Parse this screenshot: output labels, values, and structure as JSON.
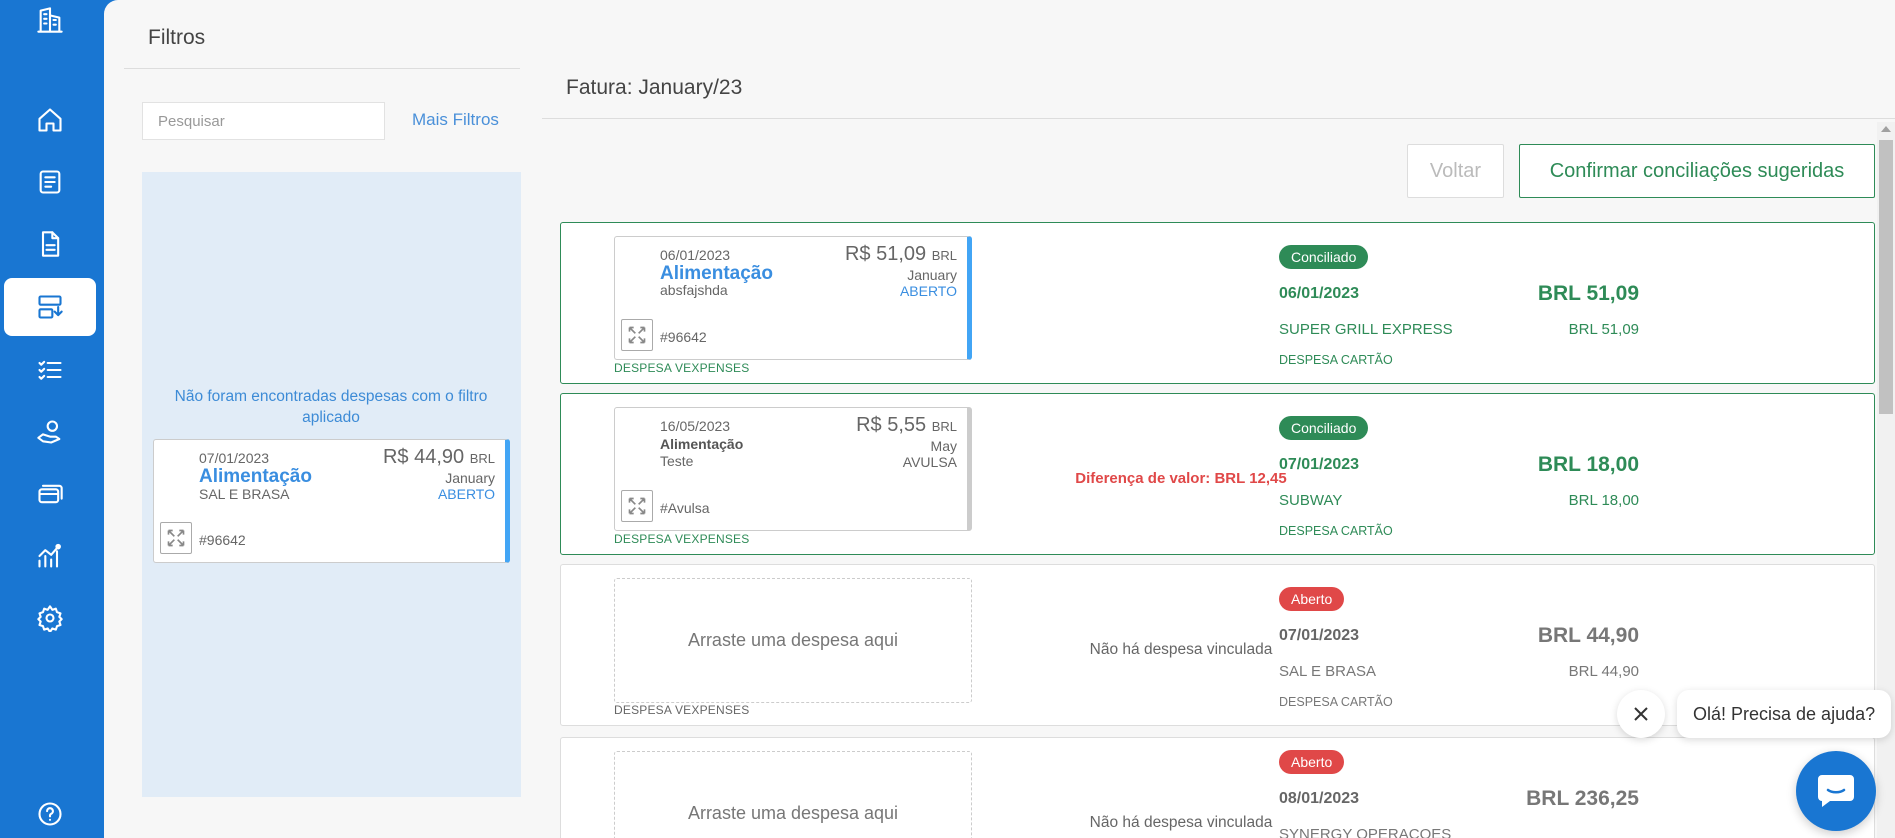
{
  "sidebar": {
    "items": [
      {
        "icon": "building-icon"
      },
      {
        "icon": "home-icon"
      },
      {
        "icon": "receipt-icon"
      },
      {
        "icon": "document-icon"
      },
      {
        "icon": "reconcile-icon",
        "active": true
      },
      {
        "icon": "checklist-icon"
      },
      {
        "icon": "hand-coin-icon"
      },
      {
        "icon": "cards-icon"
      },
      {
        "icon": "analytics-icon"
      },
      {
        "icon": "settings-icon"
      },
      {
        "icon": "help-icon"
      }
    ]
  },
  "filters": {
    "title": "Filtros",
    "search_placeholder": "Pesquisar",
    "more_filters": "Mais Filtros",
    "no_results": "Não foram encontradas despesas com o filtro aplicado",
    "card": {
      "date": "07/01/2023",
      "category": "Alimentação",
      "description": "SAL E BRASA",
      "amount": "R$ 44,90",
      "currency": "BRL",
      "month": "January",
      "status": "ABERTO",
      "id": "#96642"
    }
  },
  "main": {
    "title": "Fatura: January/23",
    "back_button": "Voltar",
    "confirm_button": "Confirmar conciliações sugeridas",
    "expense_label": "DESPESA VEXPENSES",
    "drop_text": "Arraste uma despesa aqui",
    "no_link_text": "Não há despesa vinculada",
    "rows": [
      {
        "expense": {
          "date": "06/01/2023",
          "category": "Alimentação",
          "description": "absfajshda",
          "amount": "R$ 51,09",
          "currency": "BRL",
          "month": "January",
          "status": "ABERTO",
          "id": "#96642"
        },
        "card": {
          "badge": "Conciliado",
          "date": "06/01/2023",
          "total": "BRL 51,09",
          "merchant": "SUPER GRILL EXPRESS",
          "amount": "BRL 51,09",
          "type": "DESPESA CARTÃO"
        }
      },
      {
        "expense": {
          "date": "16/05/2023",
          "category": "Alimentação",
          "description": "Teste",
          "amount": "R$ 5,55",
          "currency": "BRL",
          "month": "May",
          "status": "AVULSA",
          "id": "#Avulsa"
        },
        "difference": "Diferença de valor: BRL 12,45",
        "card": {
          "badge": "Conciliado",
          "date": "07/01/2023",
          "total": "BRL 18,00",
          "merchant": "SUBWAY",
          "amount": "BRL 18,00",
          "type": "DESPESA CARTÃO"
        }
      },
      {
        "card": {
          "badge": "Aberto",
          "date": "07/01/2023",
          "total": "BRL 44,90",
          "merchant": "SAL E BRASA",
          "amount": "BRL 44,90",
          "type": "DESPESA CARTÃO"
        }
      },
      {
        "card": {
          "badge": "Aberto",
          "date": "08/01/2023",
          "total": "BRL 236,25",
          "merchant": "SYNERGY OPERACOES"
        }
      }
    ]
  },
  "chat": {
    "greeting": "Olá! Precisa de ajuda?"
  },
  "colors": {
    "primary": "#1976d2",
    "success": "#2e8b57",
    "danger": "#e04848",
    "link": "#3a8ee0"
  }
}
